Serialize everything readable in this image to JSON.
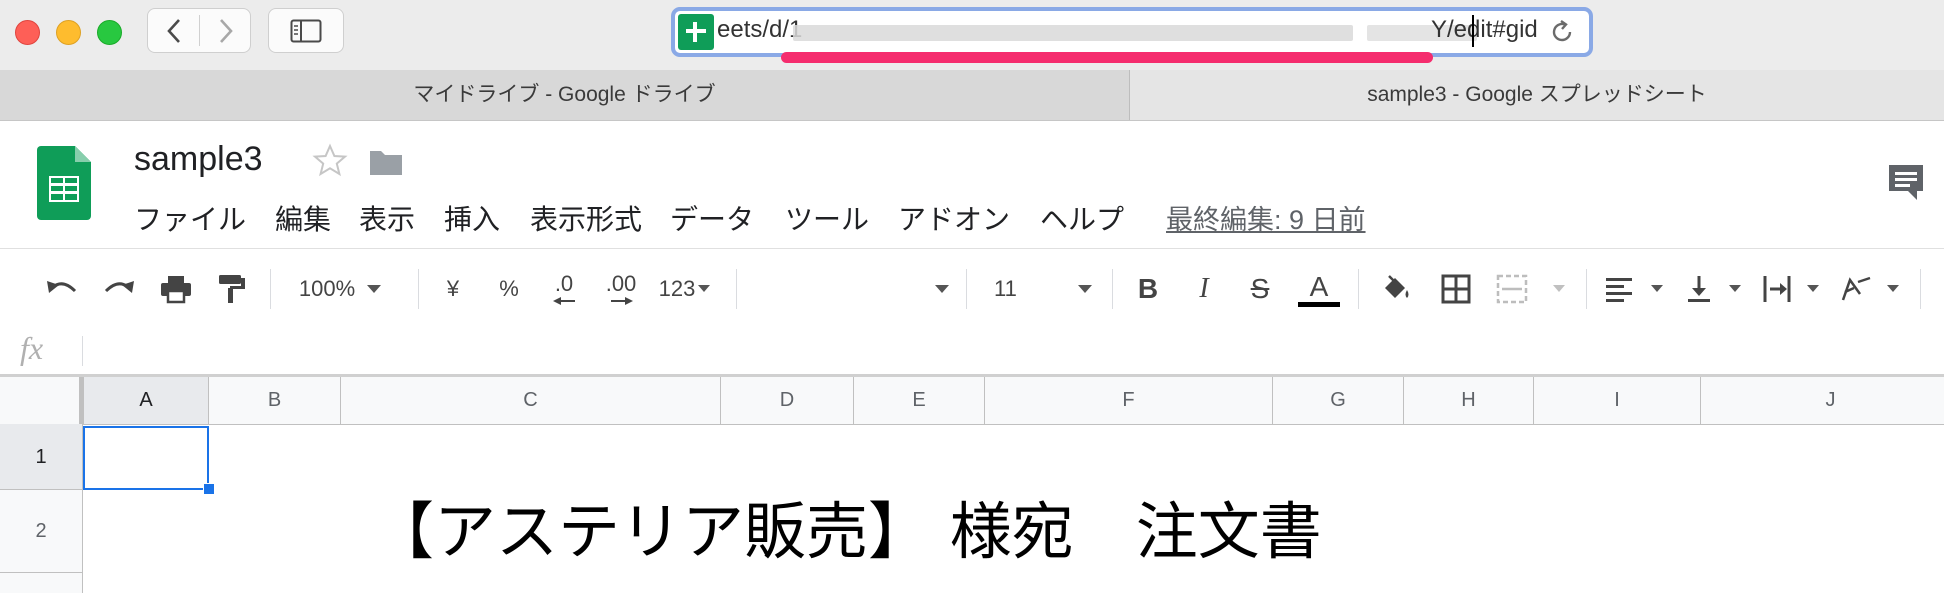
{
  "browser": {
    "url_text_start": "eets/d/1",
    "url_text_end": "Y/edit#gid",
    "tabs": [
      {
        "label": "マイドライブ - Google ドライブ",
        "active": false
      },
      {
        "label": "sample3 - Google スプレッドシート",
        "active": true
      }
    ]
  },
  "doc": {
    "title": "sample3",
    "last_edit": "最終編集: 9 日前"
  },
  "menu": [
    "ファイル",
    "編集",
    "表示",
    "挿入",
    "表示形式",
    "データ",
    "ツール",
    "アドオン",
    "ヘルプ"
  ],
  "toolbar": {
    "zoom": "100%",
    "currency": "¥",
    "percent": "%",
    "dec_decrease": ".0",
    "dec_increase": ".00",
    "more_formats": "123",
    "font_size": "11",
    "bold": "B",
    "italic": "I",
    "strike": "S",
    "text_color_glyph": "A"
  },
  "formula": {
    "fx": "fx"
  },
  "sheet": {
    "columns": [
      "A",
      "B",
      "C",
      "D",
      "E",
      "F",
      "G",
      "H",
      "I",
      "J"
    ],
    "rows": [
      "1",
      "2"
    ],
    "cell_c2": "【アステリア販売】 様宛　注文書"
  },
  "colors": {
    "sheets_green": "#0f9d58",
    "accent_blue": "#1a73e8",
    "highlight_pink": "#f52d6e"
  }
}
